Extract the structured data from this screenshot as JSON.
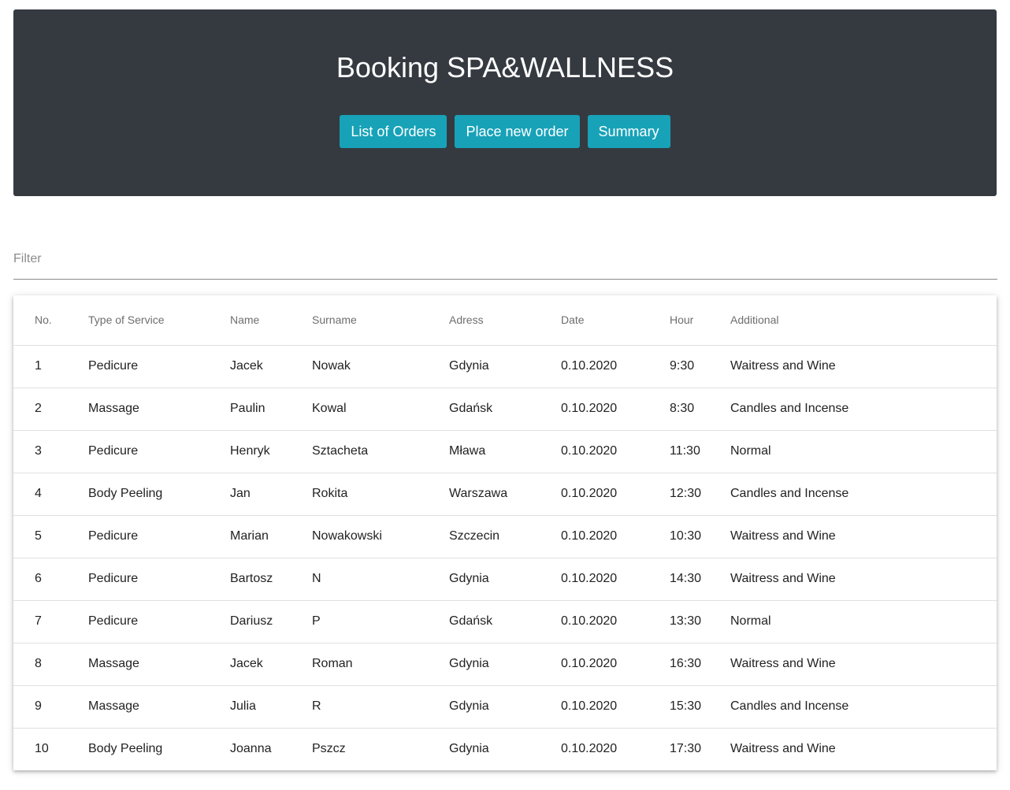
{
  "header": {
    "title": "Booking SPA&WALLNESS",
    "nav": [
      "List of Orders",
      "Place new order",
      "Summary"
    ]
  },
  "filter": {
    "placeholder": "Filter",
    "value": ""
  },
  "table": {
    "columns": [
      "No.",
      "Type of Service",
      "Name",
      "Surname",
      "Adress",
      "Date",
      "Hour",
      "Additional"
    ],
    "rows": [
      [
        "1",
        "Pedicure",
        "Jacek",
        "Nowak",
        "Gdynia",
        "0.10.2020",
        "9:30",
        "Waitress and Wine"
      ],
      [
        "2",
        "Massage",
        "Paulin",
        "Kowal",
        "Gdańsk",
        "0.10.2020",
        "8:30",
        "Candles and Incense"
      ],
      [
        "3",
        "Pedicure",
        "Henryk",
        "Sztacheta",
        "Mława",
        "0.10.2020",
        "11:30",
        "Normal"
      ],
      [
        "4",
        "Body Peeling",
        "Jan",
        "Rokita",
        "Warszawa",
        "0.10.2020",
        "12:30",
        "Candles and Incense"
      ],
      [
        "5",
        "Pedicure",
        "Marian",
        "Nowakowski",
        "Szczecin",
        "0.10.2020",
        "10:30",
        "Waitress and Wine"
      ],
      [
        "6",
        "Pedicure",
        "Bartosz",
        "N",
        "Gdynia",
        "0.10.2020",
        "14:30",
        "Waitress and Wine"
      ],
      [
        "7",
        "Pedicure",
        "Dariusz",
        "P",
        "Gdańsk",
        "0.10.2020",
        "13:30",
        "Normal"
      ],
      [
        "8",
        "Massage",
        "Jacek",
        "Roman",
        "Gdynia",
        "0.10.2020",
        "16:30",
        "Waitress and Wine"
      ],
      [
        "9",
        "Massage",
        "Julia",
        "R",
        "Gdynia",
        "0.10.2020",
        "15:30",
        "Candles and Incense"
      ],
      [
        "10",
        "Body Peeling",
        "Joanna",
        "Pszcz",
        "Gdynia",
        "0.10.2020",
        "17:30",
        "Waitress and Wine"
      ]
    ]
  },
  "colors": {
    "header_bg": "#353a41",
    "button_bg": "#17a2b8",
    "button_text": "#ffffff"
  }
}
